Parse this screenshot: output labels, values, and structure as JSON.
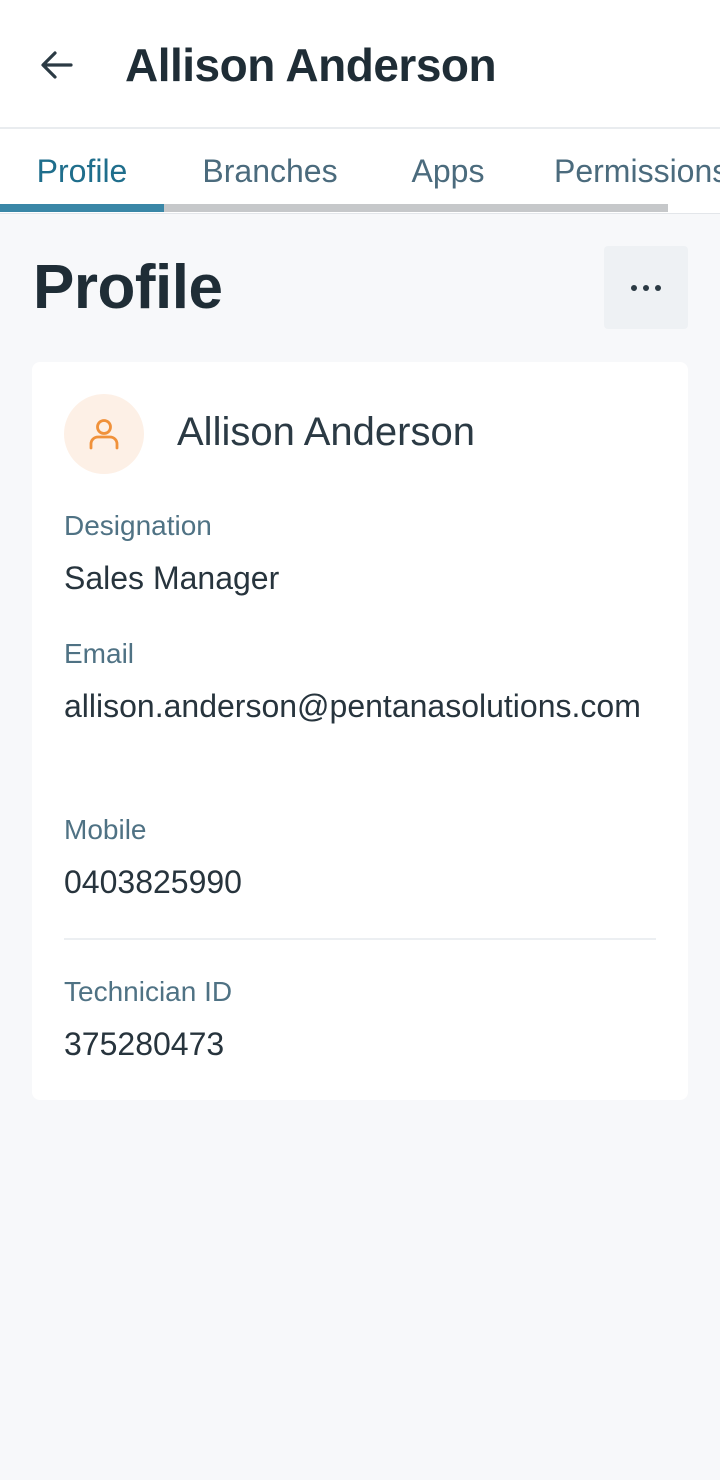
{
  "header": {
    "title": "Allison Anderson"
  },
  "tabs": [
    {
      "label": "Profile"
    },
    {
      "label": "Branches"
    },
    {
      "label": "Apps"
    },
    {
      "label": "Permissions"
    }
  ],
  "section": {
    "title": "Profile"
  },
  "card": {
    "name": "Allison Anderson",
    "fields": [
      {
        "label": "Designation",
        "value": "Sales Manager"
      },
      {
        "label": "Email",
        "value": "allison.anderson@pentanasolutions.com"
      },
      {
        "label": "Mobile",
        "value": "0403825990"
      },
      {
        "label": "Technician ID",
        "value": "375280473"
      }
    ]
  },
  "colors": {
    "accent": "#3a87a7",
    "avatar_bg": "#fdf0e6",
    "avatar_icon": "#f0913a"
  },
  "icons": {
    "back": "arrow-left-icon",
    "more": "more-horizontal-icon",
    "avatar": "user-icon"
  }
}
